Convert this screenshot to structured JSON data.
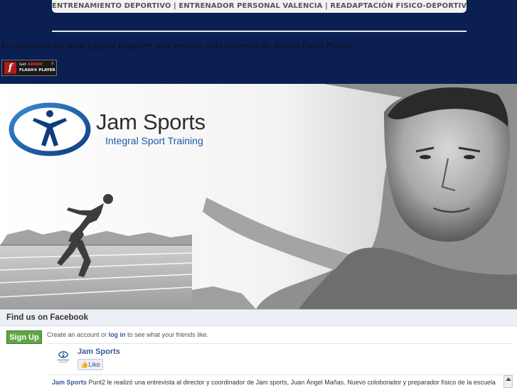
{
  "header": {
    "tagline": "ENTRENAMIENTO DEPORTIVO | ENTRENADOR PERSONAL VALENCIA | READAPTACIÓN FISICO-DEPORTIVA",
    "flash_message": "El contenido de esta página requiere una versión más reciente de Adobe Flash Player.",
    "flash_badge": {
      "line1_prefix": "Get ",
      "line1_brand": "ADOBE",
      "line2": "FLASH® PLAYER"
    }
  },
  "hero": {
    "brand_name": "Jam Sports",
    "brand_tagline": "Integral Sport Training"
  },
  "facebook": {
    "title": "Find us on Facebook",
    "signup_label": "Sign Up",
    "create_prefix": "Create an account or ",
    "login_link": "log in",
    "create_suffix": " to see what your friends like.",
    "page_name": "Jam Sports",
    "like_label": "Like",
    "post_author": "Jam Sports",
    "post_text": " Punt2 le realizó una entrevista al director y coordinador de Jam sports, Juan Ángel Mañas. Nuevo coloborador y preparador físico de la escuela"
  },
  "colors": {
    "header_bg": "#0b1f52",
    "facebook_blue": "#3b5998",
    "signup_green": "#5fa645",
    "logo_blue": "#1a5aa8"
  }
}
